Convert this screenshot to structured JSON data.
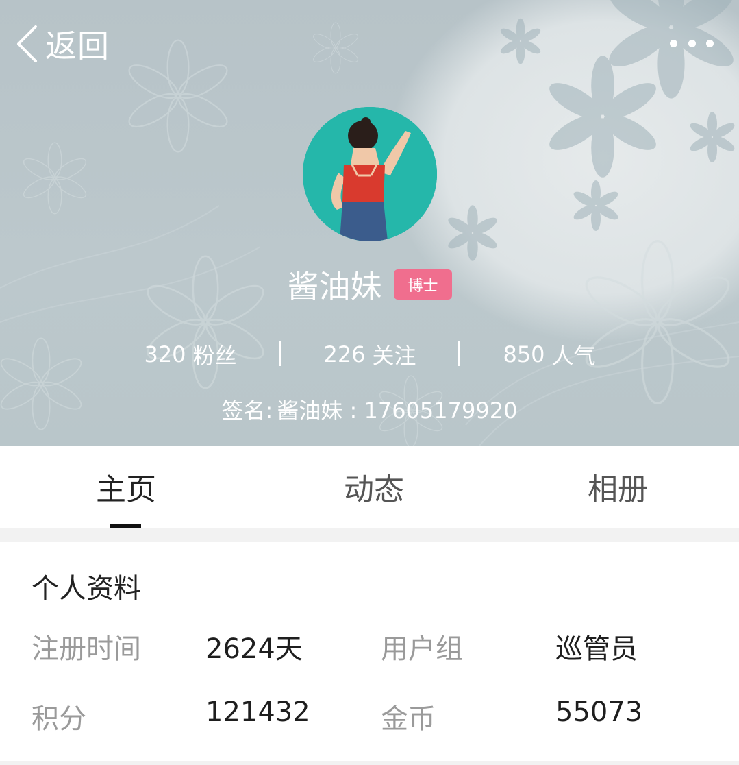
{
  "header": {
    "back_label": "返回",
    "name": "酱油妹",
    "badge": "博士",
    "stats": [
      {
        "value": "320",
        "label": "粉丝"
      },
      {
        "value": "226",
        "label": "关注"
      },
      {
        "value": "850",
        "label": "人气"
      }
    ],
    "signature_label": "签名:",
    "signature_text": "酱油妹 : 17605179920"
  },
  "icons": {
    "back": "chevron-left-icon",
    "more": "more-dots-icon",
    "avatar": "avatar-image"
  },
  "colors": {
    "badge_bg": "#f06e8e",
    "cover_bg": "#b9c6ca",
    "avatar_bg": "#22b3a7"
  },
  "tabs": [
    {
      "label": "主页",
      "active": true
    },
    {
      "label": "动态",
      "active": false
    },
    {
      "label": "相册",
      "active": false
    }
  ],
  "profile": {
    "title": "个人资料",
    "fields": [
      {
        "label": "注册时间",
        "value": "2624天"
      },
      {
        "label": "用户组",
        "value": "巡管员"
      },
      {
        "label": "积分",
        "value": "121432"
      },
      {
        "label": "金币",
        "value": "55073"
      }
    ]
  }
}
